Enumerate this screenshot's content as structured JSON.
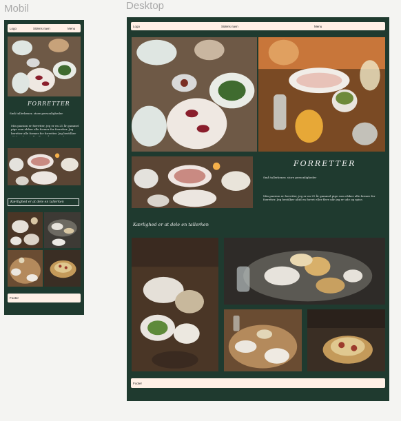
{
  "labels": {
    "mobile": "Mobil",
    "desktop": "Desktop"
  },
  "nav": {
    "logo": "Logo",
    "page_name": "Sidens navn",
    "menu": "Menu"
  },
  "section": {
    "title": "FORRETTER",
    "subtitle": "Små tallerkener, store personligheder",
    "body_mobile": "Min passion er forretter, jeg er en 21 år gammel pige som elsker alle former for forretter. Jeg beretter alle former for forretter. Jeg bestilker altid en forret eller flere når jeg er ud...",
    "body_desktop": "Min passion er forretter, jeg er en 21 år gammel pige som elsker alle former for forretter. Jeg bestilker altid en forret eller flere når jeg er ude og spise."
  },
  "gallery": {
    "heading": "Kærlighed er at dele en tallerken"
  },
  "footer": {
    "label": "Footer"
  },
  "colors": {
    "frame_bg": "#1f3a2f",
    "bar_bg": "#fff0e6",
    "label_gray": "#a9a9a9"
  }
}
